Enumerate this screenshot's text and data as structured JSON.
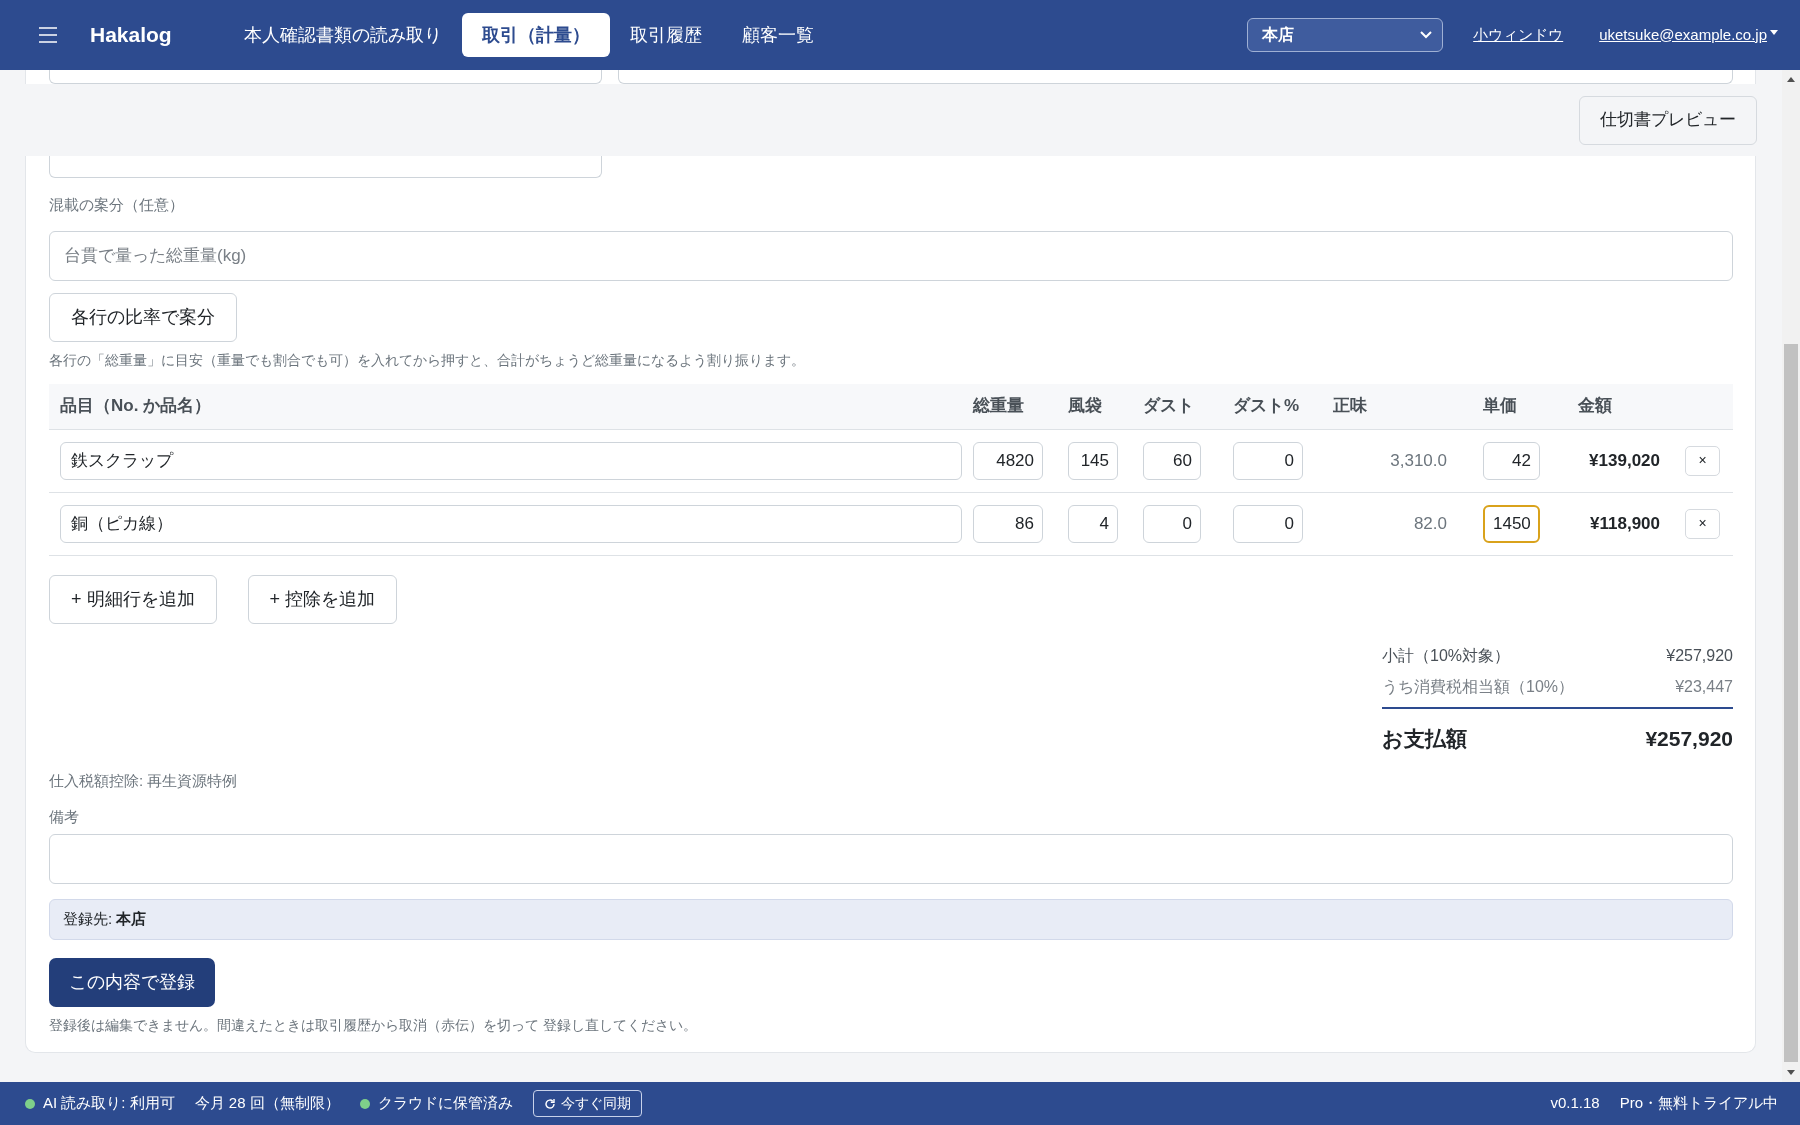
{
  "navbar": {
    "brand": "Hakalog",
    "tabs": [
      {
        "label": "本人確認書類の読み取り",
        "selected": false
      },
      {
        "label": "取引（計量）",
        "selected": true
      },
      {
        "label": "取引履歴",
        "selected": false
      },
      {
        "label": "顧客一覧",
        "selected": false
      }
    ],
    "store_select": {
      "value": "本店"
    },
    "mini_window_link": "小ウィンドウ",
    "user_menu": "uketsuke@example.co.jp"
  },
  "toolbar": {
    "preview_button": "仕切書プレビュー"
  },
  "allocation": {
    "label": "混載の案分（任意）",
    "total_weight": {
      "placeholder": "台貫で量った総重量(kg)"
    },
    "button": "各行の比率で案分",
    "hint": "各行の「総重量」に目安（重量でも割合でも可）を入れてから押すと、合計がちょうど総重量になるよう割り振ります。"
  },
  "table": {
    "columns": [
      "品目（No. か品名）",
      "総重量",
      "風袋",
      "ダスト",
      "ダスト%",
      "正味",
      "単価",
      "金額"
    ],
    "rows": [
      {
        "item": "鉄スクラップ",
        "gross": "4820",
        "tare": "145",
        "dust": "60",
        "dust_pct": "0",
        "net": "3,310.0",
        "unit_price": "42",
        "unit_price_focused": false,
        "amount": "¥139,020",
        "remove": "×"
      },
      {
        "item": "銅（ピカ線）",
        "gross": "86",
        "tare": "4",
        "dust": "0",
        "dust_pct": "0",
        "net": "82.0",
        "unit_price": "1450",
        "unit_price_focused": true,
        "amount": "¥118,900",
        "remove": "×"
      }
    ]
  },
  "add_buttons": [
    "+ 明細行を追加",
    "+ 控除を追加"
  ],
  "totals": {
    "subtotal_label": "小計（10%対象）",
    "subtotal": "¥257,920",
    "tax_label": "うち消費税相当額（10%）",
    "tax": "¥23,447",
    "total_label": "お支払額",
    "total": "¥257,920"
  },
  "tax_note": "仕入税額控除: 再生資源特例",
  "remarks": {
    "label": "備考"
  },
  "destination": "登録先: **本店**",
  "submit_button": "この内容で登録",
  "submit_hint": "登録後は編集できません。間違えたときは取引履歴から取消（赤伝）を切って 登録し直してください。",
  "status_bar": {
    "ai": {
      "text": "AI 読み取り: 利用可",
      "color": "#7ed08a"
    },
    "usage": "今月 28 回（無制限）",
    "cloud": {
      "text": "クラウドに保管済み",
      "color": "#7ed08a"
    },
    "sync_button": "今すぐ同期",
    "version": "v0.1.18",
    "plan": "Pro・無料トライアル中"
  }
}
